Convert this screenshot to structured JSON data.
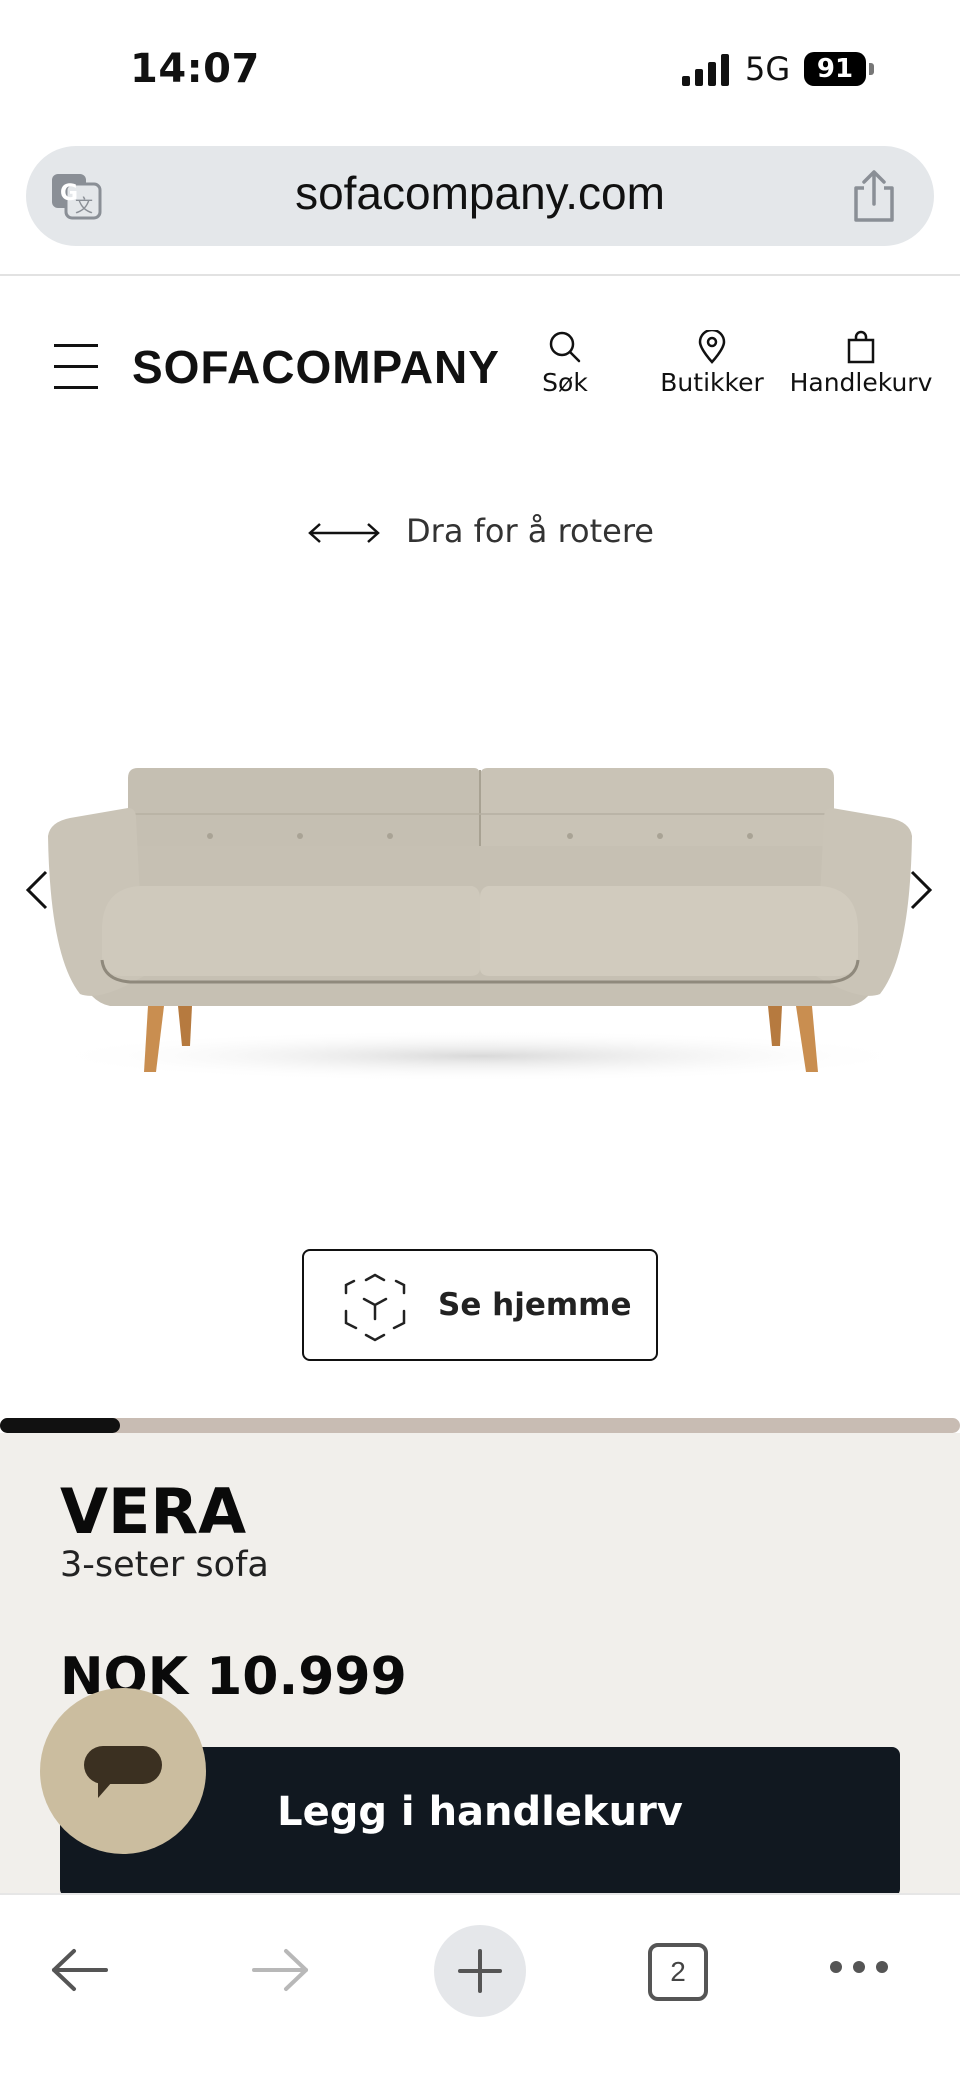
{
  "status_bar": {
    "time": "14:07",
    "network": "5G",
    "battery": "91"
  },
  "browser": {
    "url": "sofacompany.com",
    "tab_count": "2"
  },
  "header": {
    "logo": "SOFACOMPANY",
    "nav": {
      "search": "Søk",
      "stores": "Butikker",
      "cart": "Handlekurv"
    }
  },
  "viewer": {
    "rotate_hint": "Dra for å rotere",
    "ar_button": "Se hjemme",
    "gallery_progress": 0.125
  },
  "product": {
    "name": "VERA",
    "subtitle": "3-seter sofa",
    "price": "NOK 10.999",
    "add_to_cart": "Legg i handlekurv"
  },
  "colors": {
    "sofa_fabric": "#c9c4b7",
    "sofa_legs": "#c98e50",
    "info_bg": "#f1efeb",
    "cta_bg": "#111820",
    "chat_bg": "#cbbd9f",
    "progress_track": "#c8bcb3"
  }
}
